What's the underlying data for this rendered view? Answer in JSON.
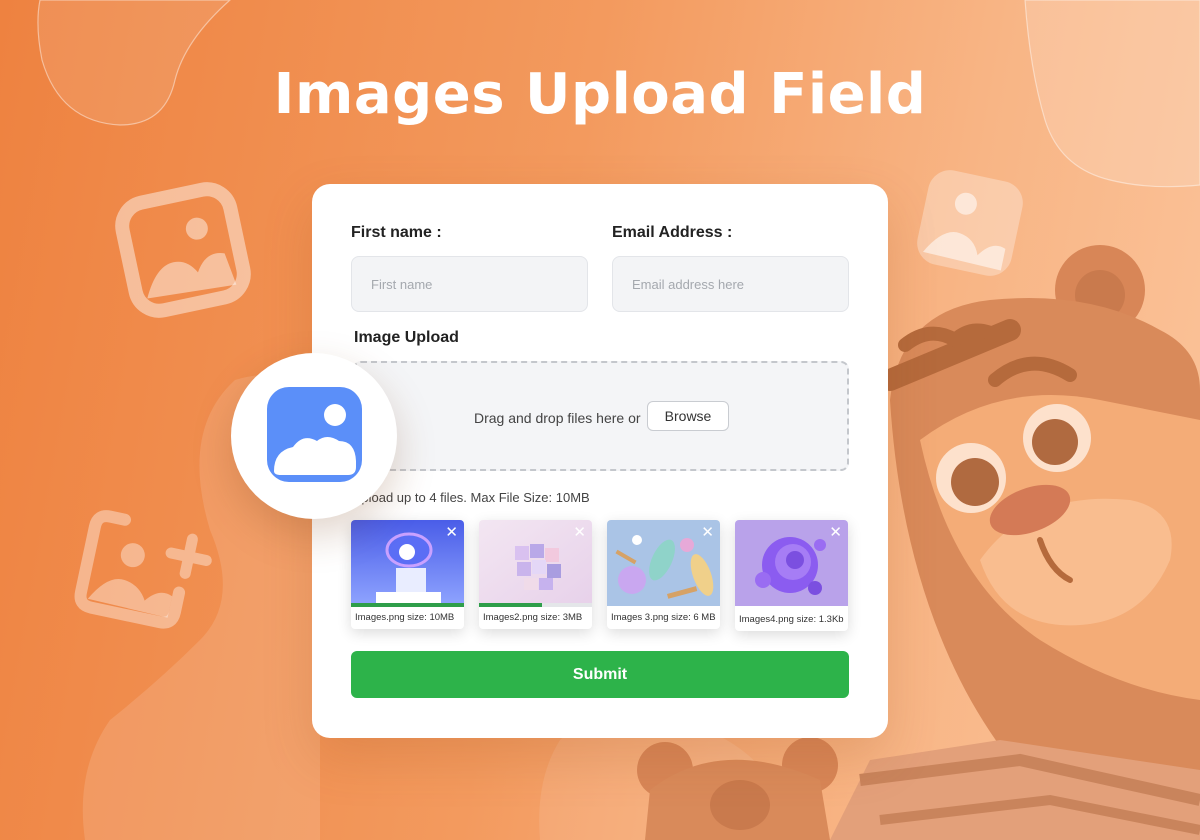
{
  "page": {
    "title": "Images Upload Field",
    "accent_color": "#2db34a",
    "brand_icon_color": "#5b8ff9"
  },
  "form": {
    "first_name": {
      "label": "First name :",
      "placeholder": "First name",
      "value": ""
    },
    "email": {
      "label": "Email Address :",
      "placeholder": "Email address here",
      "value": ""
    },
    "upload": {
      "label": "Image Upload",
      "drop_text": "Drag and drop files here or",
      "browse_label": "Browse",
      "hint": "Upload up to 4 files. Max File Size: 10MB"
    },
    "files": [
      {
        "caption": "Images.png size: 10MB",
        "progress": 1.0,
        "icon": "close-icon"
      },
      {
        "caption": "Images2.png size: 3MB",
        "progress": 0.56,
        "icon": "close-icon"
      },
      {
        "caption": "Images 3.png  size: 6 MB",
        "progress": 0.0,
        "icon": "close-icon"
      },
      {
        "caption": "Images4.png size: 1.3Kb",
        "progress": 0.0,
        "icon": "close-icon"
      }
    ],
    "close_glyph": "✕",
    "submit_label": "Submit"
  }
}
